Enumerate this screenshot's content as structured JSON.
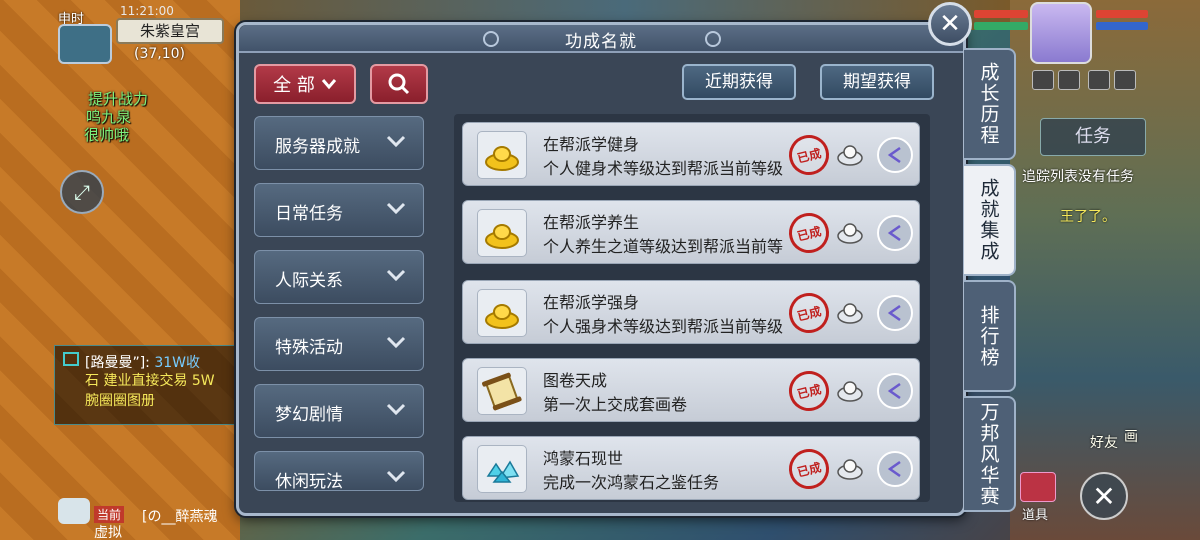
{
  "hud": {
    "time_label": "申时",
    "clock": "11:21:00",
    "location": "朱紫皇宫",
    "coords": "(37,10)",
    "side_texts": [
      "提升战力",
      "鸣九泉",
      "很帅哦"
    ],
    "task_button": "任务",
    "task_message": "追踪列表没有任务",
    "world_texts": [
      "王了了。",
      "好友",
      "画"
    ],
    "props_label": "道具"
  },
  "chat": {
    "line1_name": "[路曼曼”]:",
    "line1_text": "31W收",
    "line2": "石 建业直接交易 5W",
    "line3": "腕圈圈图册",
    "channel_tag": "当前",
    "bottom_text": "[の__醉燕魂",
    "bottom_text2": "虚拟"
  },
  "panel": {
    "title": "功成名就",
    "filter_label": "全 部",
    "recent_button": "近期获得",
    "expected_button": "期望获得"
  },
  "categories": [
    {
      "label": "服务器成就"
    },
    {
      "label": "日常任务"
    },
    {
      "label": "人际关系"
    },
    {
      "label": "特殊活动"
    },
    {
      "label": "梦幻剧情"
    },
    {
      "label": "休闲玩法"
    }
  ],
  "achievements": [
    {
      "title": "在帮派学健身",
      "desc": "个人健身术等级达到帮派当前等级",
      "icon": "gold-ingot-icon",
      "stamp": "已成"
    },
    {
      "title": "在帮派学养生",
      "desc": "个人养生之道等级达到帮派当前等",
      "icon": "gold-ingot-icon",
      "stamp": "已成"
    },
    {
      "title": "在帮派学强身",
      "desc": "个人强身术等级达到帮派当前等级",
      "icon": "gold-ingot-icon",
      "stamp": "已成"
    },
    {
      "title": "图卷天成",
      "desc": "第一次上交成套画卷",
      "icon": "scroll-icon",
      "stamp": "已成"
    },
    {
      "title": "鸿蒙石现世",
      "desc": "完成一次鸿蒙石之鉴任务",
      "icon": "crystal-icon",
      "stamp": "已成"
    }
  ],
  "side_tabs": [
    {
      "label": "成长历程",
      "active": false
    },
    {
      "label": "成就集成",
      "active": true
    },
    {
      "label": "排行榜",
      "active": false
    },
    {
      "label": "万邦风华赛",
      "active": false
    }
  ],
  "colors": {
    "accent_red": "#b23a48",
    "panel_bg": "#3a4656",
    "stamp_red": "#c0201e"
  }
}
